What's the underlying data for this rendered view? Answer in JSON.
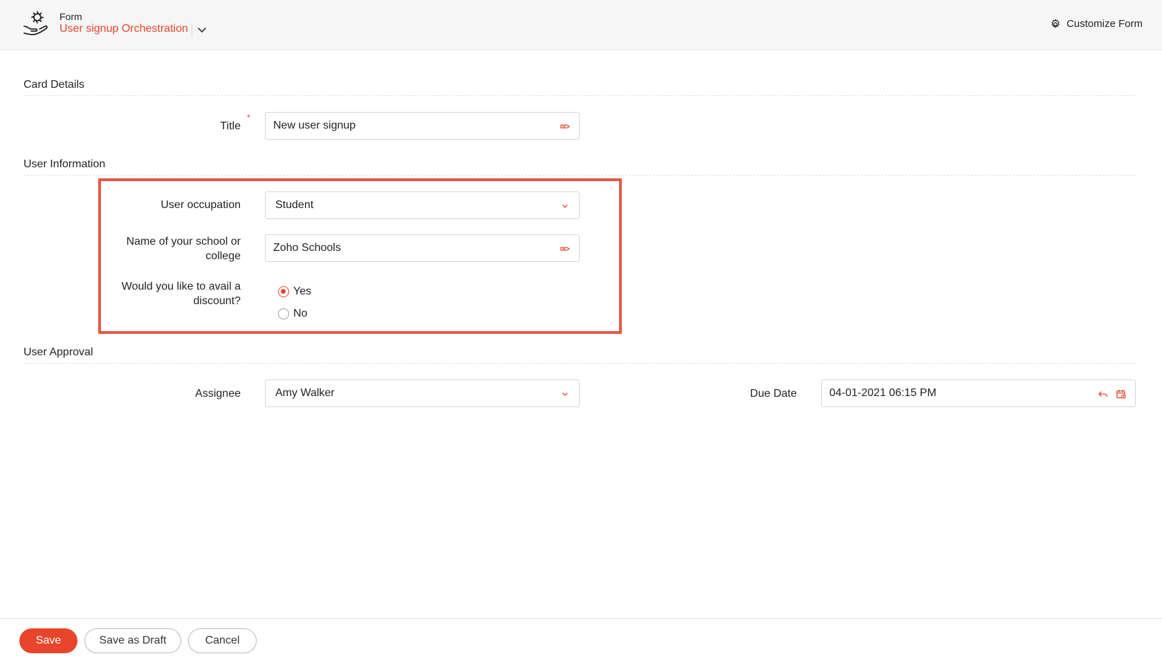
{
  "header": {
    "form_label": "Form",
    "form_name": "User signup Orchestration",
    "customize_label": "Customize Form"
  },
  "sections": {
    "card_details": "Card Details",
    "user_information": "User Information",
    "user_approval": "User Approval"
  },
  "fields": {
    "title": {
      "label": "Title",
      "required_mark": "*",
      "value": "New user signup"
    },
    "occupation": {
      "label": "User occupation",
      "value": "Student"
    },
    "school": {
      "label_line1": "Name of your school or",
      "label_line2": "college",
      "value": "Zoho Schools"
    },
    "discount": {
      "label_line1": "Would you like to avail a",
      "label_line2": "discount?",
      "options": [
        "Yes",
        "No"
      ],
      "selected": "Yes"
    },
    "assignee": {
      "label": "Assignee",
      "value": "Amy Walker"
    },
    "due_date": {
      "label": "Due Date",
      "value": "04-01-2021 06:15 PM"
    }
  },
  "footer": {
    "save_label": "Save",
    "save_draft_label": "Save as Draft",
    "cancel_label": "Cancel"
  },
  "colors": {
    "accent": "#e8452c",
    "highlight_border": "#e4574a"
  },
  "icons": {
    "app": "form-orchestration-icon",
    "chevron": "chevron-down-icon",
    "customize": "gear-icon",
    "tag": "tag-icon",
    "undo": "undo-icon",
    "calendar": "calendar-icon"
  }
}
